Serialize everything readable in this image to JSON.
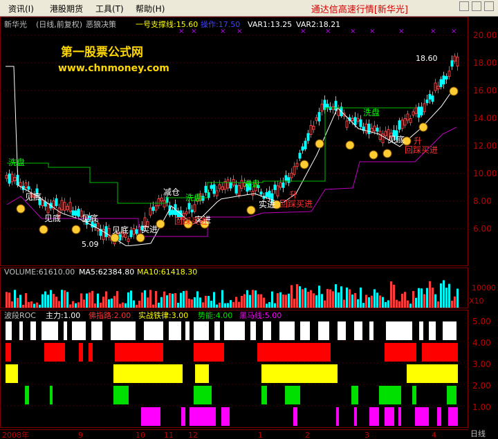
{
  "menu": {
    "items": [
      {
        "label": "资讯(I)"
      },
      {
        "label": "港股期货"
      },
      {
        "label": "工具(T)"
      },
      {
        "label": "帮助(H)"
      }
    ],
    "app_title": "通达信高速行情[新华光]"
  },
  "main": {
    "header": {
      "stock": "新华光",
      "period": "(日线,前复权)",
      "formula": "恶狼决策",
      "support": "一号支撑线:15.60",
      "operate": "操作:17.50",
      "var1": "VAR1:13.25",
      "var2": "VAR2:18.21"
    },
    "watermark_title": "第一股票公式网",
    "watermark_url": "www.chnmoney.com",
    "price_labels": {
      "high": "18.60",
      "low": "5.09"
    },
    "annotations": [
      {
        "text": "洗盘",
        "color": "#00ff00"
      },
      {
        "text": "见底",
        "color": "#ffffff"
      },
      {
        "text": "见底",
        "color": "#ffffff"
      },
      {
        "text": "见底",
        "color": "#ffffff"
      },
      {
        "text": "见底",
        "color": "#ffffff"
      },
      {
        "text": "实进",
        "color": "#ffffff"
      },
      {
        "text": "减仓",
        "color": "#ffffff"
      },
      {
        "text": "洗盘",
        "color": "#00ff00"
      },
      {
        "text": "实进",
        "color": "#ffffff"
      },
      {
        "text": "回踩买进",
        "color": "#ff3030"
      },
      {
        "text": "洗盘",
        "color": "#00ff00"
      },
      {
        "text": "实进",
        "color": "#ffffff"
      },
      {
        "text": "回踩买进",
        "color": "#ff3030"
      },
      {
        "text": "升",
        "color": "#ff3030"
      },
      {
        "text": "洗盘",
        "color": "#00ff00"
      },
      {
        "text": "见底",
        "color": "#ffffff"
      },
      {
        "text": "回踩买进",
        "color": "#ff3030"
      },
      {
        "text": "升",
        "color": "#ff3030"
      }
    ],
    "axis_ticks": [
      "20.00",
      "18.00",
      "16.00",
      "14.00",
      "12.00",
      "10.00",
      "8.00",
      "6.00"
    ]
  },
  "volume": {
    "header": {
      "volume": "VOLUME:61610.00",
      "ma5": "MA5:62384.80",
      "ma10": "MA10:61418.30"
    },
    "axis_ticks": [
      "10000",
      "X10"
    ]
  },
  "roc": {
    "header": {
      "name": "波段ROC",
      "main": "主力:1.00",
      "b": "佛指路:2.00",
      "c": "实战铁律:3.00",
      "d": "势能:4.00",
      "e": "黑马线:5.00"
    },
    "axis_ticks": [
      "5.00",
      "4.00",
      "3.00",
      "2.00",
      "1.00"
    ],
    "colors": {
      "white_band": "#ffffff",
      "red_band": "#ff0000",
      "yellow_band": "#ffff00",
      "green_band": "#00e000",
      "magenta_band": "#ff00ff"
    }
  },
  "time_axis": {
    "labels": [
      "2008年",
      "9",
      "10",
      "11",
      "12",
      "1",
      "2",
      "3",
      "4"
    ],
    "period_name": "日线"
  },
  "colors": {
    "up": "#ff3c3c",
    "down": "#00ffff",
    "grid": "#800000",
    "axis_text": "#c00000",
    "ma": "#ffffff",
    "support_green": "#00c000",
    "support_magenta": "#c000c0"
  }
}
